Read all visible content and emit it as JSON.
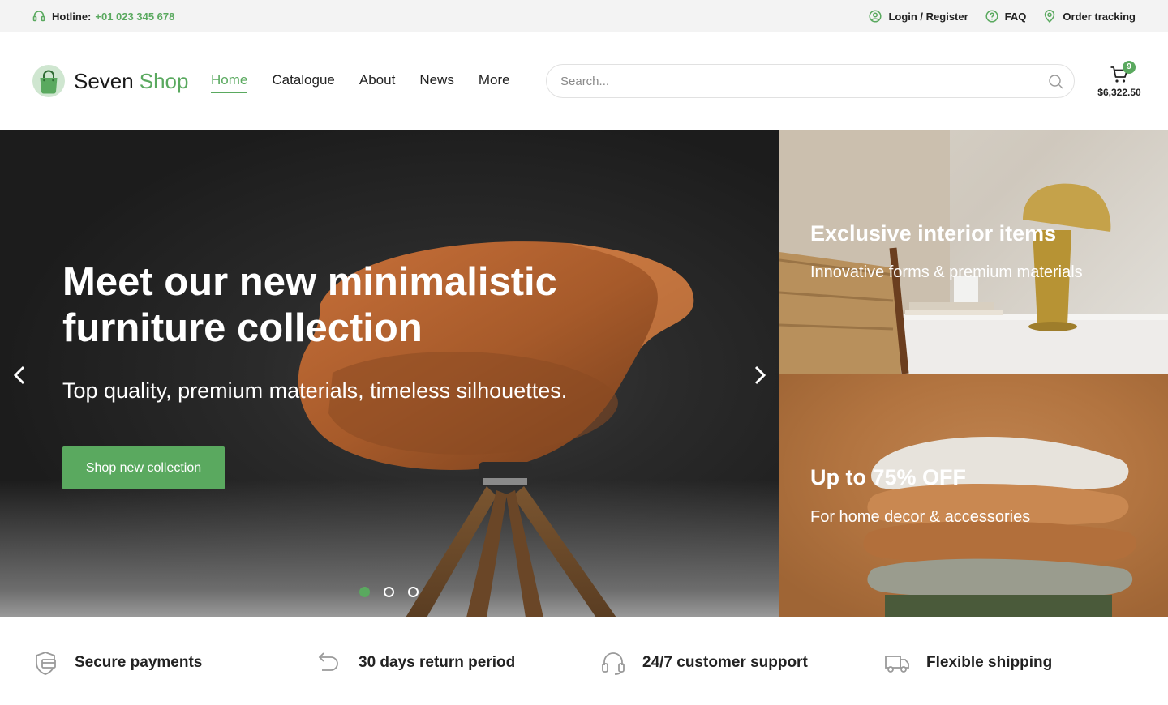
{
  "topbar": {
    "hotline_label": "Hotline:",
    "hotline_number": "+01 023 345 678",
    "links": [
      {
        "label": "Login / Register",
        "icon": "user-circle-icon"
      },
      {
        "label": "FAQ",
        "icon": "help-circle-icon"
      },
      {
        "label": "Order tracking",
        "icon": "map-pin-icon"
      }
    ]
  },
  "header": {
    "logo_word1": "Seven",
    "logo_word2": "Shop",
    "nav": [
      {
        "label": "Home",
        "active": true
      },
      {
        "label": "Catalogue",
        "active": false
      },
      {
        "label": "About",
        "active": false
      },
      {
        "label": "News",
        "active": false
      },
      {
        "label": "More",
        "active": false
      }
    ],
    "search_placeholder": "Search...",
    "cart_count": "9",
    "cart_total": "$6,322.50"
  },
  "hero": {
    "title": "Meet our new minimalistic furniture collection",
    "subtitle": "Top quality, premium materials, timeless silhouettes.",
    "cta_label": "Shop new collection",
    "slide_count": 3,
    "active_slide": 1
  },
  "promos": [
    {
      "title": "Exclusive interior items",
      "subtitle": "Innovative forms & premium materials"
    },
    {
      "title": "Up to 75% OFF",
      "subtitle": "For home decor & accessories"
    }
  ],
  "features": [
    {
      "label": "Secure payments",
      "icon": "shield-card-icon"
    },
    {
      "label": "30 days return period",
      "icon": "return-arrow-icon"
    },
    {
      "label": "24/7 customer support",
      "icon": "headphones-icon"
    },
    {
      "label": "Flexible shipping",
      "icon": "truck-icon"
    }
  ],
  "colors": {
    "accent": "#5aa95f",
    "topbar_bg": "#f3f3f3",
    "text": "#222222"
  }
}
